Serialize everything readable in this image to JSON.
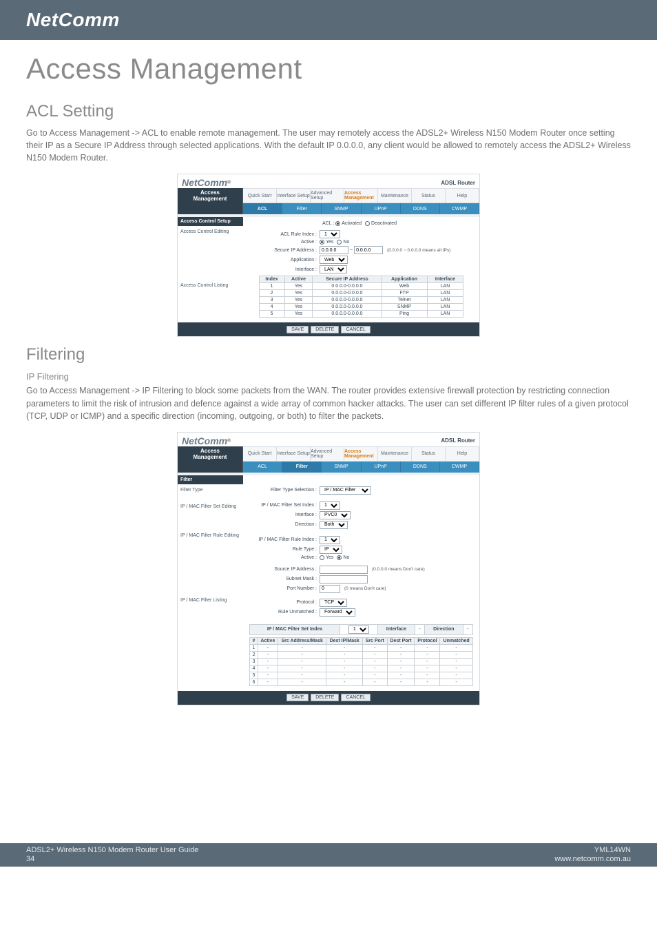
{
  "brand": "NetComm",
  "page_title": "Access Management",
  "sections": {
    "acl": {
      "title": "ACL Setting",
      "paragraph": "Go to Access Management -> ACL to enable remote management. The user may remotely access the ADSL2+ Wireless N150 Modem Router once setting their IP as a Secure IP Address through selected applications. With the default IP 0.0.0.0, any client would be allowed to remotely access the ADSL2+ Wireless N150 Modem Router."
    },
    "filtering": {
      "title": "Filtering",
      "sub_title": "IP Filtering",
      "paragraph": "Go to Access Management -> IP Filtering to block some packets from the WAN. The router provides extensive firewall protection by restricting connection parameters to limit the risk of intrusion and defence against a wide array of common hacker attacks. The user can set different IP filter rules of a given protocol (TCP, UDP or ICMP) and a specific direction (incoming, outgoing, or both) to filter the packets."
    }
  },
  "screenshot_common": {
    "logo": "NetComm",
    "logo_reg": "®",
    "model": "ADSL Router",
    "side_label_line1": "Access",
    "side_label_line2": "Management",
    "top_tabs": [
      "Quick Start",
      "Interface Setup",
      "Advanced Setup",
      "Access Management",
      "Maintenance",
      "Status",
      "Help"
    ],
    "sub_tabs": [
      "ACL",
      "Filter",
      "SNMP",
      "UPnP",
      "DDNS",
      "CWMP"
    ],
    "buttons": {
      "save": "SAVE",
      "delete": "DELETE",
      "cancel": "CANCEL"
    }
  },
  "acl_shot": {
    "active_sub": "ACL",
    "left_heading": "Access Control Setup",
    "left_items": [
      "Access Control Editing",
      "Access Control Listing"
    ],
    "fields": {
      "acl_label": "ACL :",
      "acl_option_on": "Activated",
      "acl_option_off": "Deactivated",
      "rule_index_label": "ACL Rule Index :",
      "rule_index_value": "1",
      "active_label": "Active :",
      "active_yes": "Yes",
      "active_no": "No",
      "secure_ip_label": "Secure IP Address :",
      "secure_ip_from": "0.0.0.0",
      "secure_ip_sep": "~",
      "secure_ip_to": "0.0.0.0",
      "secure_ip_hint": "(0.0.0.0 ~ 0.0.0.0 means all IPs)",
      "application_label": "Application :",
      "application_value": "Web",
      "interface_label": "Interface :",
      "interface_value": "LAN"
    },
    "listing": {
      "headers": [
        "Index",
        "Active",
        "Secure IP Address",
        "Application",
        "Interface"
      ],
      "rows": [
        [
          "1",
          "Yes",
          "0.0.0.0-0.0.0.0",
          "Web",
          "LAN"
        ],
        [
          "2",
          "Yes",
          "0.0.0.0-0.0.0.0",
          "FTP",
          "LAN"
        ],
        [
          "3",
          "Yes",
          "0.0.0.0-0.0.0.0",
          "Telnet",
          "LAN"
        ],
        [
          "4",
          "Yes",
          "0.0.0.0-0.0.0.0",
          "SNMP",
          "LAN"
        ],
        [
          "5",
          "Yes",
          "0.0.0.0-0.0.0.0",
          "Ping",
          "LAN"
        ]
      ]
    }
  },
  "filter_shot": {
    "active_sub": "Filter",
    "left_heading": "Filter",
    "left_items": [
      "Filter Type",
      "IP / MAC Filter Set Editing",
      "IP / MAC Filter Rule Editing",
      "IP / MAC Filter Listing"
    ],
    "fields": {
      "filter_type_label": "Filter Type Selection :",
      "filter_type_value": "IP / MAC Filter",
      "set_index_label": "IP / MAC Filter Set Index :",
      "set_index_value": "1",
      "interface_label": "Interface :",
      "interface_value": "PVC0",
      "direction_label": "Direction :",
      "direction_value": "Both",
      "rule_index_label": "IP / MAC Filter Rule Index :",
      "rule_index_value": "1",
      "rule_type_label": "Rule Type :",
      "rule_type_value": "IP",
      "active_label": "Active :",
      "active_yes": "Yes",
      "active_no": "No",
      "src_ip_label": "Source IP Address :",
      "src_ip_hint": "(0.0.0.0 means Don't care)",
      "subnet_label": "Subnet Mask :",
      "port_label": "Port Number :",
      "port_value": "0",
      "port_hint": "(0 means Don't care)",
      "protocol_label": "Protocol :",
      "protocol_value": "TCP",
      "rule_unmatched_label": "Rule Unmatched :",
      "rule_unmatched_value": "Forward"
    },
    "listing_top": {
      "set_index_label": "IP / MAC Filter Set Index",
      "set_index_value": "1",
      "iface_label": "Interface",
      "iface_value": "-",
      "dir_label": "Direction",
      "dir_value": "-"
    },
    "listing": {
      "headers": [
        "#",
        "Active",
        "Src Address/Mask",
        "Dest IP/Mask",
        "Src Port",
        "Dest Port",
        "Protocol",
        "Unmatched"
      ],
      "rows": [
        [
          "1",
          "-",
          "-",
          "-",
          "-",
          "-",
          "-",
          "-"
        ],
        [
          "2",
          "-",
          "-",
          "-",
          "-",
          "-",
          "-",
          "-"
        ],
        [
          "3",
          "-",
          "-",
          "-",
          "-",
          "-",
          "-",
          "-"
        ],
        [
          "4",
          "-",
          "-",
          "-",
          "-",
          "-",
          "-",
          "-"
        ],
        [
          "5",
          "-",
          "-",
          "-",
          "-",
          "-",
          "-",
          "-"
        ],
        [
          "6",
          "-",
          "-",
          "-",
          "-",
          "-",
          "-",
          "-"
        ]
      ]
    }
  },
  "footer": {
    "left_line1": "ADSL2+ Wireless N150 Modem Router User Guide",
    "left_line2": "34",
    "right_line1": "YML14WN",
    "right_line2": "www.netcomm.com.au"
  }
}
